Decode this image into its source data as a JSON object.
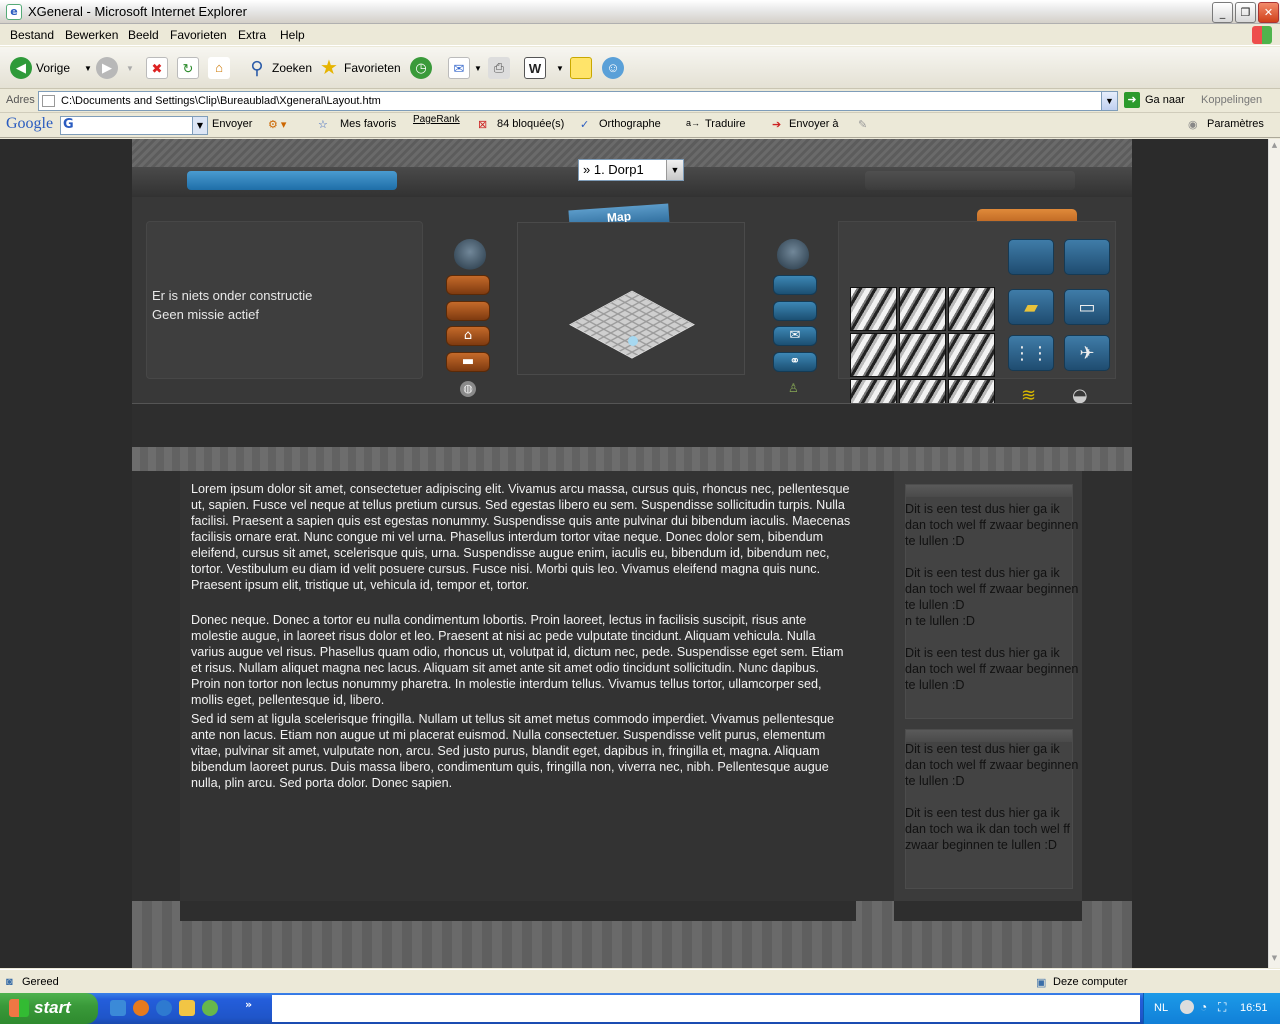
{
  "window": {
    "title": "XGeneral - Microsoft Internet Explorer"
  },
  "menu": [
    "Bestand",
    "Bewerken",
    "Beeld",
    "Favorieten",
    "Extra",
    "Help"
  ],
  "toolbar": {
    "back": "Vorige",
    "search": "Zoeken",
    "favorites": "Favorieten"
  },
  "address": {
    "label": "Adres",
    "url": "C:\\Documents and Settings\\Clip\\Bureaublad\\Xgeneral\\Layout.htm",
    "go": "Ga naar",
    "links": "Koppelingen"
  },
  "googlebar": {
    "logo": "Google",
    "send": "Envoyer",
    "favs": "Mes favoris",
    "pagerank": "PageRank",
    "blocked": "84 bloquée(s)",
    "spell": "Orthographe",
    "translate": "Traduire",
    "sendto": "Envoyer à",
    "settings": "Paramètres"
  },
  "game": {
    "village_select": "» 1. Dorp1",
    "map_tab": "Map",
    "status_construction": "Er is niets onder constructie",
    "status_mission": "Geen missie actief"
  },
  "content": {
    "paragraphs": [
      "Lorem ipsum dolor sit amet, consectetuer adipiscing elit. Vivamus arcu massa, cursus quis, rhoncus nec, pellentesque ut, sapien. Fusce vel neque at tellus pretium cursus. Sed egestas libero eu sem. Suspendisse sollicitudin turpis. Nulla facilisi. Praesent a sapien quis est egestas nonummy. Suspendisse quis ante pulvinar dui bibendum iaculis. Maecenas facilisis ornare erat. Nunc congue mi vel urna. Phasellus interdum tortor vitae neque. Donec dolor sem, bibendum eleifend, cursus sit amet, scelerisque quis, urna. Suspendisse augue enim, iaculis eu, bibendum id, bibendum nec, tortor. Vestibulum eu diam id velit posuere cursus. Fusce nisi. Morbi quis leo. Vivamus eleifend magna quis nunc. Praesent ipsum elit, tristique ut, vehicula id, tempor et, tortor.",
      "Donec neque. Donec a tortor eu nulla condimentum lobortis. Proin laoreet, lectus in facilisis suscipit, risus ante molestie augue, in laoreet risus dolor et leo. Praesent at nisi ac pede vulputate tincidunt. Aliquam vehicula. Nulla varius augue vel risus. Phasellus quam odio, rhoncus ut, volutpat id, dictum nec, pede. Suspendisse eget sem. Etiam et risus. Nullam aliquet magna nec lacus. Aliquam sit amet ante sit amet odio tincidunt sollicitudin. Nunc dapibus. Proin non tortor non lectus nonummy pharetra. In molestie interdum tellus. Vivamus tellus tortor, ullamcorper sed, mollis eget, pellentesque id, libero.",
      "Sed id sem at ligula scelerisque fringilla. Nullam ut tellus sit amet metus commodo imperdiet. Vivamus pellentesque ante non lacus. Etiam non augue ut mi placerat euismod. Nulla consectetuer. Suspendisse velit purus, elementum vitae, pulvinar sit amet, vulputate non, arcu. Sed justo purus, blandit eget, dapibus in, fringilla et, magna. Aliquam bibendum laoreet purus. Duis massa libero, condimentum quis, fringilla non, viverra nec, nibh. Pellentesque augue nulla, plin arcu. Sed porta dolor. Donec sapien."
    ]
  },
  "sidebar": {
    "box1": [
      "Dit is een test dus hier ga ik dan toch wel ff zwaar beginnen te lullen :D",
      "Dit is een test dus hier ga ik dan toch wel ff zwaar beginnen te lullen :D\nn te lullen :D",
      "Dit is een test dus hier ga ik dan toch wel ff zwaar beginnen te lullen :D"
    ],
    "box2": [
      "Dit is een test dus hier ga ik dan toch wel ff zwaar beginnen te lullen :D",
      "Dit is een test dus hier ga ik dan toch wa ik dan toch wel ff zwaar beginnen te lullen :D"
    ]
  },
  "status": {
    "left": "Gereed",
    "zone": "Deze computer"
  },
  "taskbar": {
    "start": "start",
    "lang": "NL",
    "clock": "16:51"
  }
}
